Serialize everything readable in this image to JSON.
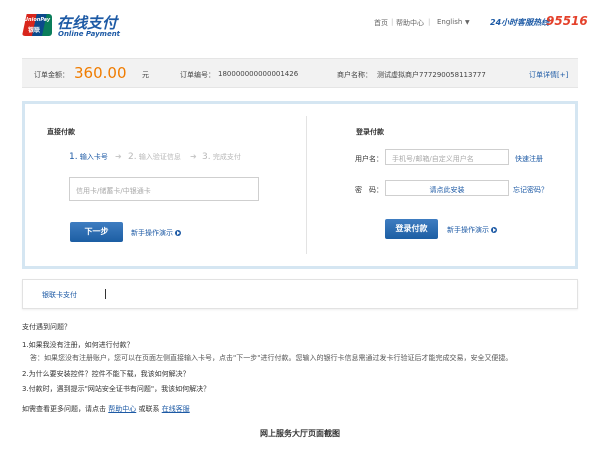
{
  "header": {
    "logo_text_top": "UnionPay",
    "logo_text_bottom": "银联",
    "brand_cn": "在线支付",
    "brand_en": "Online Payment",
    "nav_home": "首页",
    "nav_sep": "|",
    "nav_help": "帮助中心",
    "nav_lang": "English",
    "hotline_label": "24小时客服热线",
    "hotline_number": "95516"
  },
  "order": {
    "amount_label": "订单金额：",
    "amount_value": "360.00",
    "amount_unit": "元",
    "order_no_label": "订单编号：",
    "order_no": "180000000000001426",
    "merchant_label": "商户名称：",
    "merchant": "测试虚拟商户777290058113777",
    "detail_link": "订单详情[+]"
  },
  "direct_pay": {
    "title": "直接付款",
    "step1_num": "1.",
    "step1": "输入卡号",
    "step2_num": "2.",
    "step2": "输入验证信息",
    "step3_num": "3.",
    "step3": "完成支付",
    "card_placeholder": "信用卡/储蓄卡/中银通卡",
    "next_button": "下一步",
    "demo_link": "新手操作演示"
  },
  "login_pay": {
    "title": "登录付款",
    "username_label": "用户名：",
    "username_placeholder": "手机号/邮箱/自定义用户名",
    "register_link": "快速注册",
    "password_label": "密　码：",
    "password_placeholder": "请点此安装",
    "forgot_link": "忘记密码？",
    "login_button": "登录付款",
    "demo_link": "新手操作演示"
  },
  "tabs": {
    "unionpay_card": "银联卡支付"
  },
  "faq": {
    "title": "支付遇到问题？",
    "q1": "1.如果我没有注册，如何进行付款？",
    "a1": "答：如果您没有注册账户，您可以在页面左侧直接输入卡号，点击\"下一步\"进行付款。您输入的银行卡信息需通过发卡行验证后才能完成交易，安全又便捷。",
    "q2": "2.为什么要安装控件？控件不能下载，我该如何解决？",
    "q3": "3.付款时，遇到提示\"网站安全证书有问题\"，我该如何解决？",
    "more_prefix": "如需查看更多问题，请点击",
    "help_center": "帮助中心",
    "or_contact": "或联系",
    "online_service": "在线客服"
  },
  "caption": "网上服务大厅页面截图",
  "colors": {
    "brand_blue": "#1d5aa5",
    "amount_orange": "#f07c00",
    "hotline_red": "#e4412b"
  }
}
